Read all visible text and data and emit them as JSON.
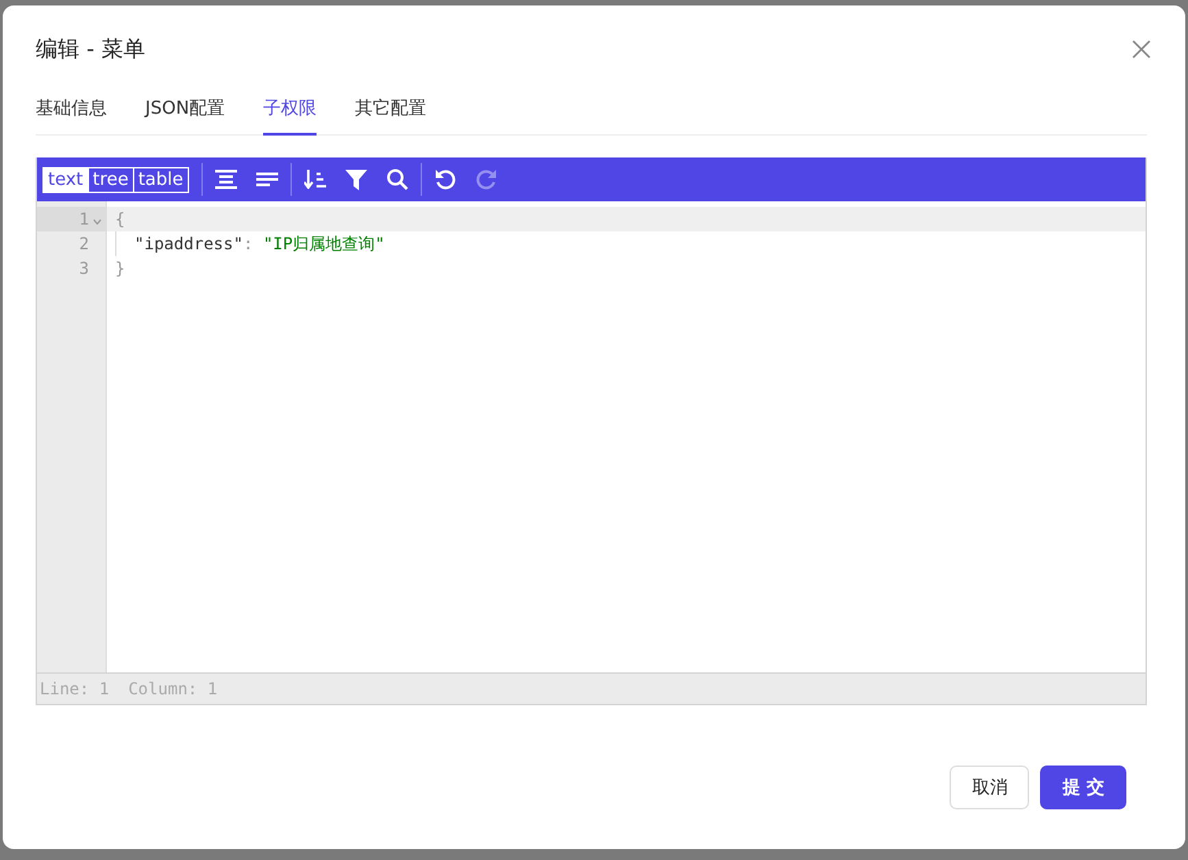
{
  "dialog": {
    "title": "编辑 - 菜单"
  },
  "tabs": [
    {
      "label": "基础信息",
      "selected": false
    },
    {
      "label": "JSON配置",
      "selected": false
    },
    {
      "label": "子权限",
      "selected": true
    },
    {
      "label": "其它配置",
      "selected": false
    }
  ],
  "editor": {
    "modes": [
      {
        "label": "text",
        "selected": true
      },
      {
        "label": "tree",
        "selected": false
      },
      {
        "label": "table",
        "selected": false
      }
    ],
    "tools": [
      {
        "kind": "format",
        "disabled": false
      },
      {
        "kind": "compact",
        "disabled": false
      },
      {
        "kind": "sort",
        "disabled": false
      },
      {
        "kind": "filter",
        "disabled": false
      },
      {
        "kind": "search",
        "disabled": false
      },
      {
        "kind": "undo",
        "disabled": false
      },
      {
        "kind": "redo",
        "disabled": true
      }
    ],
    "lines": [
      {
        "number": "1",
        "active": true,
        "foldable": true,
        "indented": false,
        "tokens": [
          {
            "kind": "punct",
            "text": "{"
          }
        ]
      },
      {
        "number": "2",
        "active": false,
        "foldable": false,
        "indented": true,
        "tokens": [
          {
            "kind": "key",
            "text": "\"ipaddress\""
          },
          {
            "kind": "punct",
            "text": ": "
          },
          {
            "kind": "string",
            "text": "\"IP归属地查询\""
          }
        ]
      },
      {
        "number": "3",
        "active": false,
        "foldable": false,
        "indented": false,
        "tokens": [
          {
            "kind": "punct",
            "text": "}"
          }
        ]
      }
    ],
    "status": [
      "Line: 1",
      "Column: 1"
    ]
  },
  "buttons": [
    {
      "label": "取消",
      "kind": "default"
    },
    {
      "label": "提 交",
      "kind": "primary"
    }
  ]
}
